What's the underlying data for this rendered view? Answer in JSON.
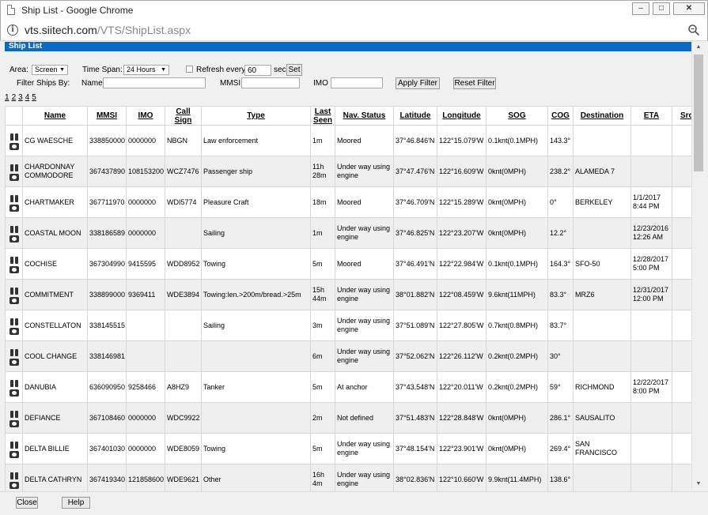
{
  "window": {
    "title": "Ship List - Google Chrome",
    "min": "–",
    "max": "□",
    "close": "✕"
  },
  "address": {
    "host": "vts.siitech.com",
    "path": "/VTS/ShipList.aspx"
  },
  "page": {
    "header": "Ship List"
  },
  "controls": {
    "area_label": "Area:",
    "area_value": "Screen",
    "timespan_label": "Time Span:",
    "timespan_value": "24 Hours",
    "refresh_label": "Refresh every",
    "refresh_value": "60",
    "refresh_unit": "sec",
    "set_label": "Set",
    "filter_label": "Filter Ships By:",
    "name_label": "Name",
    "mmsi_label": "MMSI",
    "imo_label": "IMO",
    "apply_label": "Apply Filter",
    "reset_label": "Reset Filter"
  },
  "pager": [
    "1",
    "2",
    "3",
    "4",
    "5"
  ],
  "columns": [
    "",
    "Name",
    "MMSI",
    "IMO",
    "Call Sign",
    "Type",
    "Last Seen",
    "Nav. Status",
    "Latitude",
    "Longitude",
    "SOG",
    "COG",
    "Destination",
    "ETA",
    "Src"
  ],
  "rows": [
    [
      "CG WAESCHE",
      "338850000",
      "0000000",
      "NBGN",
      "Law enforcement",
      "1m",
      "Moored",
      "37°46.846'N",
      "122°15.079'W",
      "0.1knt(0.1MPH)",
      "143.3°",
      "",
      "",
      ""
    ],
    [
      "CHARDONNAY COMMODORE",
      "367437890",
      "108153200",
      "WCZ7476",
      "Passenger ship",
      "11h 28m",
      "Under way using engine",
      "37°47.476'N",
      "122°16.609'W",
      "0knt(0MPH)",
      "238.2°",
      "ALAMEDA 7",
      "",
      ""
    ],
    [
      "CHARTMAKER",
      "367711970",
      "0000000",
      "WDI5774",
      "Pleasure Craft",
      "18m",
      "Moored",
      "37°46.709'N",
      "122°15.289'W",
      "0knt(0MPH)",
      "0°",
      "BERKELEY",
      "1/1/2017 8:44 PM",
      ""
    ],
    [
      "COASTAL MOON",
      "338186589",
      "0000000",
      "",
      "Sailing",
      "1m",
      "Under way using engine",
      "37°46.825'N",
      "122°23.207'W",
      "0knt(0MPH)",
      "12.2°",
      "",
      "12/23/2016 12:26 AM",
      ""
    ],
    [
      "COCHISE",
      "367304990",
      "9415595",
      "WDD8952",
      "Towing",
      "5m",
      "Moored",
      "37°46.491'N",
      "122°22.984'W",
      "0.1knt(0.1MPH)",
      "164.3°",
      "SFO-50",
      "12/28/2017 5:00 PM",
      ""
    ],
    [
      "COMMITMENT",
      "338899000",
      "9369411",
      "WDE3894",
      "Towing:len.>200m/bread.>25m",
      "15h 44m",
      "Under way using engine",
      "38°01.882'N",
      "122°08.459'W",
      "9.6knt(11MPH)",
      "83.3°",
      "MRZ6",
      "12/31/2017 12:00 PM",
      ""
    ],
    [
      "CONSTELLATON",
      "338145515",
      "",
      "",
      "Sailing",
      "3m",
      "Under way using engine",
      "37°51.089'N",
      "122°27.805'W",
      "0.7knt(0.8MPH)",
      "83.7°",
      "",
      "",
      ""
    ],
    [
      "COOL CHANGE",
      "338146981",
      "",
      "",
      "",
      "6m",
      "Under way using engine",
      "37°52.062'N",
      "122°26.112'W",
      "0.2knt(0.2MPH)",
      "30°",
      "",
      "",
      ""
    ],
    [
      "DANUBIA",
      "636090950",
      "9258466",
      "A8HZ9",
      "Tanker",
      "5m",
      "At anchor",
      "37°43.548'N",
      "122°20.011'W",
      "0.2knt(0.2MPH)",
      "59°",
      "RICHMOND",
      "12/22/2017 8:00 PM",
      ""
    ],
    [
      "DEFIANCE",
      "367108460",
      "0000000",
      "WDC9922",
      "",
      "2m",
      "Not defined",
      "37°51.483'N",
      "122°28.848'W",
      "0knt(0MPH)",
      "286.1°",
      "SAUSALITO",
      "",
      ""
    ],
    [
      "DELTA BILLIE",
      "367401030",
      "0000000",
      "WDE8059",
      "Towing",
      "5m",
      "Under way using engine",
      "37°48.154'N",
      "122°23.901'W",
      "0knt(0MPH)",
      "269.4°",
      "SAN FRANCISCO",
      "",
      ""
    ],
    [
      "DELTA CATHRYN",
      "367419340",
      "121858600",
      "WDE9621",
      "Other",
      "16h 4m",
      "Under way using engine",
      "38°02.836'N",
      "122°10.660'W",
      "9.9knt(11.4MPH)",
      "138.6°",
      "",
      "",
      ""
    ]
  ],
  "footer": {
    "close_label": "Close",
    "help_label": "Help"
  }
}
